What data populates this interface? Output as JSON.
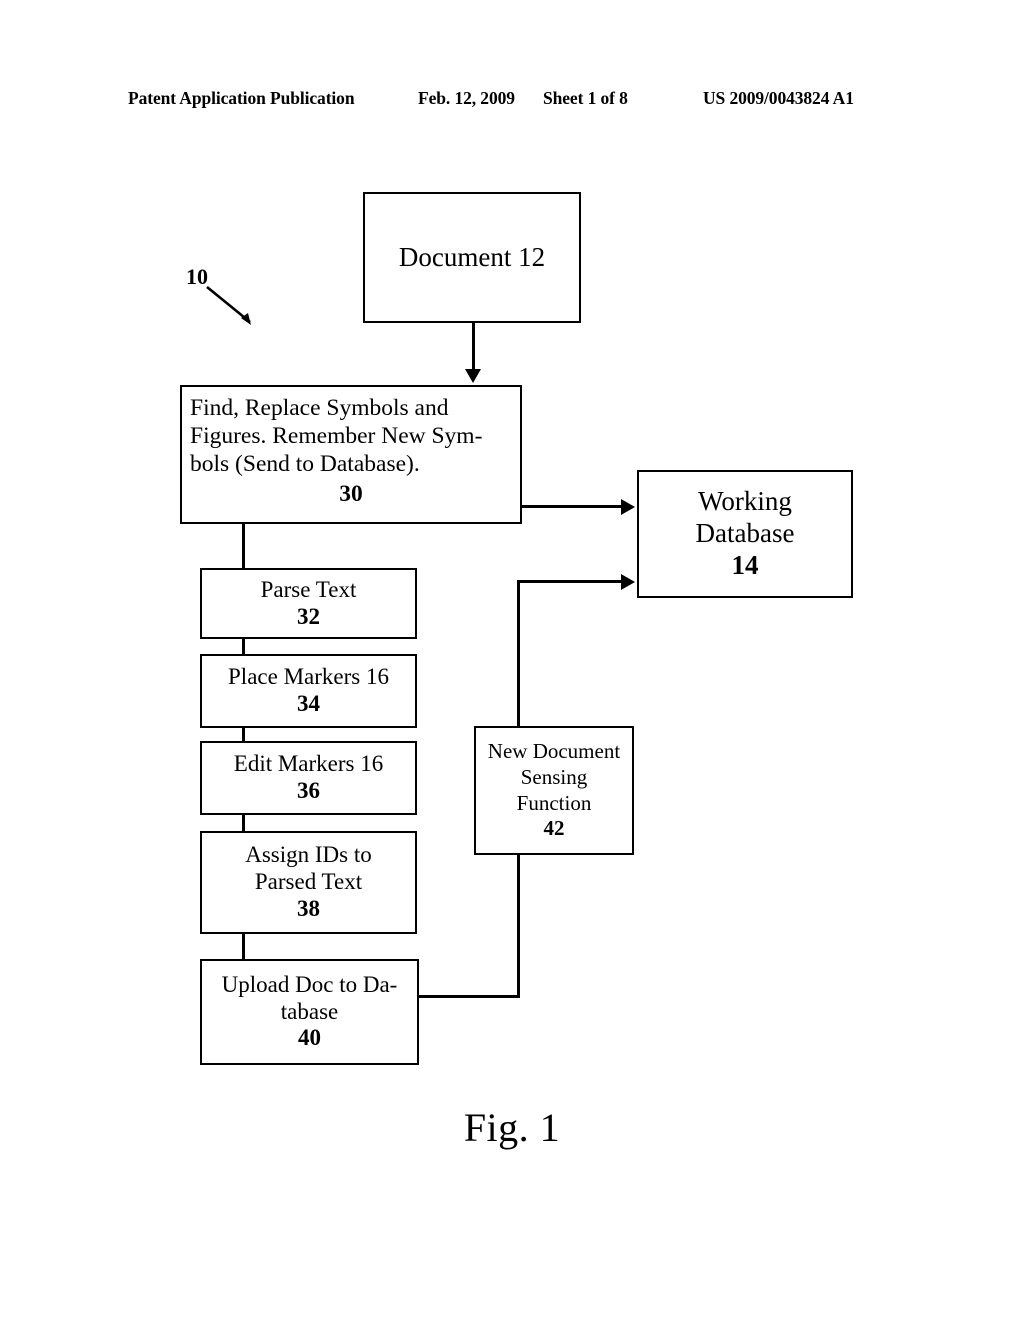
{
  "header": {
    "publication": "Patent Application Publication",
    "date": "Feb. 12, 2009",
    "sheet": "Sheet 1 of 8",
    "patent_number": "US 2009/0043824 A1"
  },
  "figure": {
    "caption": "Fig. 1",
    "system_label": "10"
  },
  "diagram": {
    "document": {
      "text": "Document 12"
    },
    "find_replace": {
      "line1": "Find, Replace Symbols and",
      "line2": "Figures.  Remember New Sym-",
      "line3": "bols (Send to Database).",
      "ref": "30"
    },
    "working_database": {
      "line1": "Working",
      "line2": "Database",
      "ref": "14"
    },
    "parse_text": {
      "text": "Parse Text",
      "ref": "32"
    },
    "place_markers": {
      "text": "Place Markers 16",
      "ref": "34"
    },
    "edit_markers": {
      "text": "Edit Markers 16",
      "ref": "36"
    },
    "assign_ids": {
      "line1": "Assign IDs to",
      "line2": "Parsed Text",
      "ref": "38"
    },
    "upload_doc": {
      "line1": "Upload Doc to Da-",
      "line2": "tabase",
      "ref": "40"
    },
    "new_doc_sensing": {
      "line1": "New Document",
      "line2": "Sensing",
      "line3": "Function",
      "ref": "42"
    }
  }
}
